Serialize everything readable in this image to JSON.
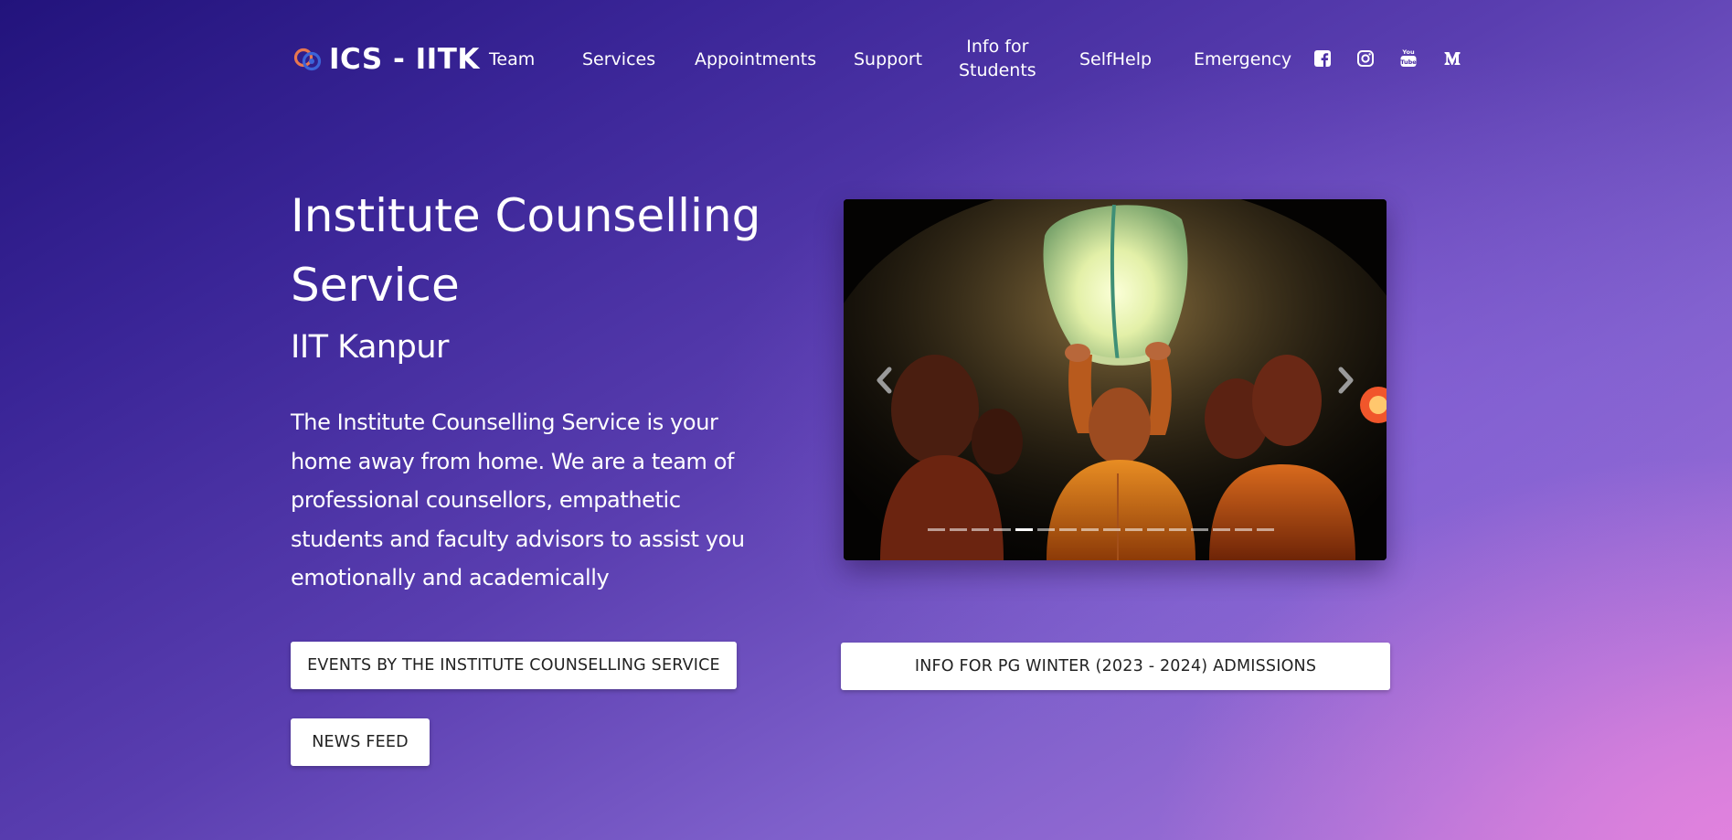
{
  "header": {
    "logo_text": "ICS - IITK",
    "nav": [
      {
        "label": "Team"
      },
      {
        "label": "Services"
      },
      {
        "label": "Appointments"
      },
      {
        "label": "Support"
      },
      {
        "label_line1": "Info for",
        "label_line2": "Students"
      },
      {
        "label": "SelfHelp"
      },
      {
        "label": "Emergency"
      }
    ],
    "social_icons": [
      "facebook-icon",
      "instagram-icon",
      "youtube-icon",
      "medium-icon"
    ]
  },
  "hero": {
    "title": "Institute Counselling Service",
    "subtitle": "IIT Kanpur",
    "description": "The Institute Counselling Service is your home away from home. We are a team of professional counsellors, empathetic students and faculty advisors to assist you emotionally and academically"
  },
  "buttons": {
    "events": "EVENTS BY THE INSTITUTE COUNSELLING SERVICE",
    "news": "NEWS FEED",
    "pg_info": "INFO FOR PG WINTER (2023 - 2024) ADMISSIONS"
  },
  "carousel": {
    "slide_count": 16,
    "active_index": 4,
    "prev_icon": "chevron-left-icon",
    "next_icon": "chevron-right-icon"
  },
  "colors": {
    "bg_start": "#22137c",
    "bg_mid": "#5a3eb0",
    "bg_end": "#c47bd6",
    "logo_orange": "#e8774f",
    "logo_blue": "#3b63d8"
  }
}
